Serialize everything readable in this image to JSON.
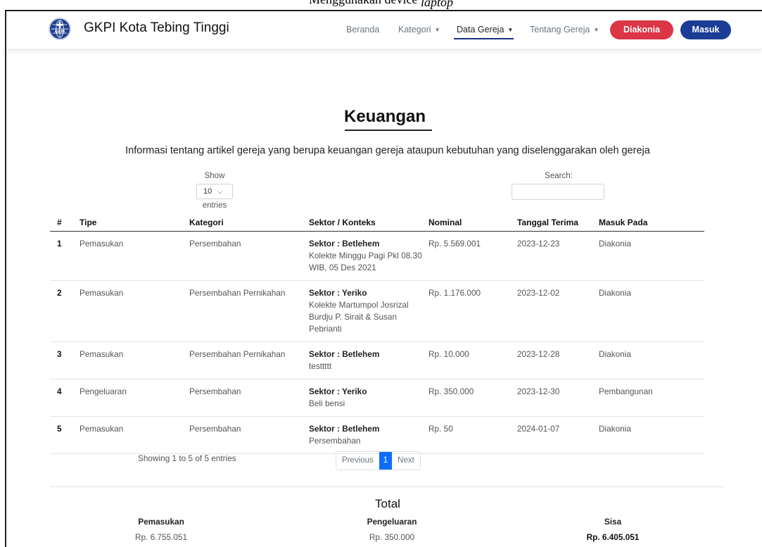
{
  "caption": {
    "text": "Menggunakan device",
    "italic": "laptop"
  },
  "navbar": {
    "brand": "GKPI Kota Tebing Tinggi",
    "logo_text": "GKPI",
    "links": [
      "Beranda",
      "Kategori",
      "Data Gereja",
      "Tentang Gereja"
    ],
    "active_link": "Data Gereja",
    "diakonia_btn": "Diakonia",
    "masuk_btn": "Masuk",
    "colors": {
      "diakonia": "#dc3545",
      "masuk": "#1c3d96"
    }
  },
  "page": {
    "title": "Keuangan",
    "subtitle": "Informasi tentang artikel gereja yang berupa keuangan gereja ataupun kebutuhan yang diselenggarakan oleh gereja"
  },
  "controls": {
    "show_label": "Show",
    "show_value": "10",
    "entries_label": "entries",
    "search_label": "Search:",
    "search_value": ""
  },
  "table": {
    "headers": [
      "#",
      "Tipe",
      "Kategori",
      "Sektor / Konteks",
      "Nominal",
      "Tanggal Terima",
      "Masuk Pada"
    ],
    "rows": [
      {
        "no": "1",
        "tipe": "Pemasukan",
        "kategori": "Persembahan",
        "sektor": "Sektor : Betlehem",
        "konteks": "Kolekte Minggu Pagi Pkl 08.30 WIB, 05 Des 2021",
        "nominal": "Rp. 5.569.001",
        "tanggal": "2023-12-23",
        "masuk": "Diakonia"
      },
      {
        "no": "2",
        "tipe": "Pemasukan",
        "kategori": "Persembahan Pernikahan",
        "sektor": "Sektor : Yeriko",
        "konteks": "Kolekte Martumpol Josrizal Burdju P. Sirait & Susan Pebrianti",
        "nominal": "Rp. 1.176.000",
        "tanggal": "2023-12-02",
        "masuk": "Diakonia"
      },
      {
        "no": "3",
        "tipe": "Pemasukan",
        "kategori": "Persembahan Pernikahan",
        "sektor": "Sektor : Betlehem",
        "konteks": "testtttt",
        "nominal": "Rp. 10.000",
        "tanggal": "2023-12-28",
        "masuk": "Diakonia"
      },
      {
        "no": "4",
        "tipe": "Pengeluaran",
        "kategori": "Persembahan",
        "sektor": "Sektor : Yeriko",
        "konteks": "Beli bensi",
        "nominal": "Rp. 350.000",
        "tanggal": "2023-12-30",
        "masuk": "Pembangunan"
      },
      {
        "no": "5",
        "tipe": "Pemasukan",
        "kategori": "Persembahan",
        "sektor": "Sektor : Betlehem",
        "konteks": "Persembahan",
        "nominal": "Rp. 50",
        "tanggal": "2024-01-07",
        "masuk": "Diakonia"
      }
    ]
  },
  "footer": {
    "info": "Showing 1 to 5 of 5 entries",
    "previous": "Previous",
    "current_page": "1",
    "next": "Next"
  },
  "total": {
    "title": "Total",
    "pemasukan_label": "Pemasukan",
    "pemasukan_value": "Rp. 6.755.051",
    "pengeluaran_label": "Pengeluaran",
    "pengeluaran_value": "Rp. 350.000",
    "sisa_label": "Sisa",
    "sisa_value": "Rp. 6.405.051"
  }
}
